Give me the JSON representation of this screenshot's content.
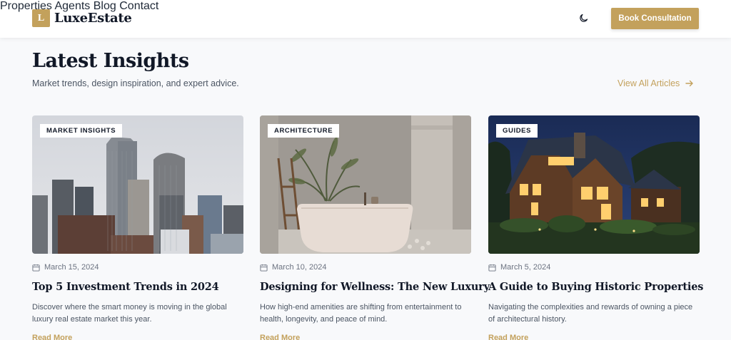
{
  "header": {
    "logo_letter": "L",
    "logo_text": "LuxeEstate",
    "nav": [
      "Properties",
      "Agents",
      "Blog",
      "Contact"
    ],
    "theme_toggle_icon": "moon-icon",
    "cta_label": "Book Consultation"
  },
  "section": {
    "title": "Latest Insights",
    "subtitle": "Market trends, design inspiration, and expert advice.",
    "view_all_label": "View All Articles",
    "view_all_icon": "arrow-right-icon"
  },
  "articles": [
    {
      "category": "MARKET INSIGHTS",
      "date": "March 15, 2024",
      "title": "Top 5 Investment Trends in 2024",
      "excerpt": "Discover where the smart money is moving in the global luxury real estate market this year.",
      "read_more": "Read More"
    },
    {
      "category": "ARCHITECTURE",
      "date": "March 10, 2024",
      "title": "Designing for Wellness: The New Luxury",
      "excerpt": "How high-end amenities are shifting from entertainment to health, longevity, and peace of mind.",
      "read_more": "Read More"
    },
    {
      "category": "GUIDES",
      "date": "March 5, 2024",
      "title": "A Guide to Buying Historic Properties",
      "excerpt": "Navigating the complexities and rewards of owning a piece of architectural history.",
      "read_more": "Read More"
    }
  ],
  "icons": {
    "date_icon": "calendar-icon"
  },
  "colors": {
    "accent": "#c3a15c",
    "heading": "#111827",
    "body_text": "#4b5563",
    "page_bg": "#f8f9fb"
  }
}
